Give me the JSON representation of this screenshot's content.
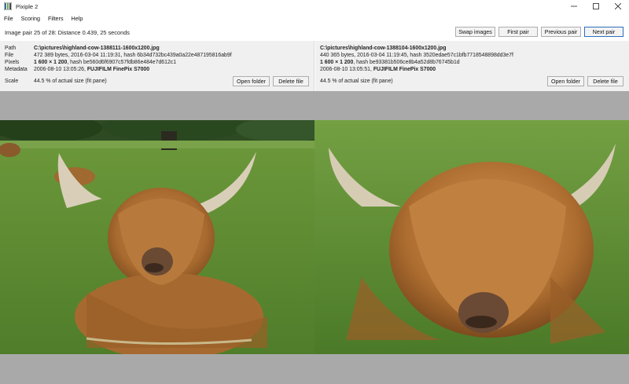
{
  "window": {
    "title": "Pixiple 2",
    "controls": [
      "minimize-icon",
      "maximize-icon",
      "close-icon"
    ]
  },
  "menu": [
    "File",
    "Scoring",
    "Filters",
    "Help"
  ],
  "toolbar": {
    "status": "Image pair 25 of 28: Distance 0.439, 25 seconds",
    "swap": "Swap images",
    "first": "First pair",
    "previous": "Previous pair",
    "next": "Next pair"
  },
  "labels": {
    "path": "Path",
    "file": "File",
    "pixels": "Pixels",
    "metadata": "Metadata",
    "scale": "Scale"
  },
  "left": {
    "path": "C:\\pictures\\highland-cow-1388111-1600x1200.jpg",
    "file": "472 389 bytes, 2016-03-04 11:19:31, hash 6b34d732bc439a0a22e487195816ab9f",
    "pixels_bold": "1 600 × 1 200",
    "pixels_rest": ", hash be560d6f6907c57fdb86e484e7d612c1",
    "metadata_date": "2006-08-10 13:05:26, ",
    "metadata_camera": "FUJIFILM FinePix S7000",
    "scale": "44.5 % of actual size (fit pane)",
    "open_folder": "Open folder",
    "delete_file": "Delete file"
  },
  "right": {
    "path": "C:\\pictures\\highland-cow-1388104-1600x1200.jpg",
    "file": "440 365 bytes, 2016-03-04 11:19:45, hash 3520edae57c1bfb7718548898dd3e7f",
    "pixels_bold": "1 600 × 1 200",
    "pixels_rest": ", hash be93381b506ce8b4a52d8b76745b1d",
    "metadata_date": "2006-08-10 13:05:51, ",
    "metadata_camera": "FUJIFILM FinePix S7000",
    "scale": "44.5 % of actual size (fit pane)",
    "open_folder": "Open folder",
    "delete_file": "Delete file"
  }
}
